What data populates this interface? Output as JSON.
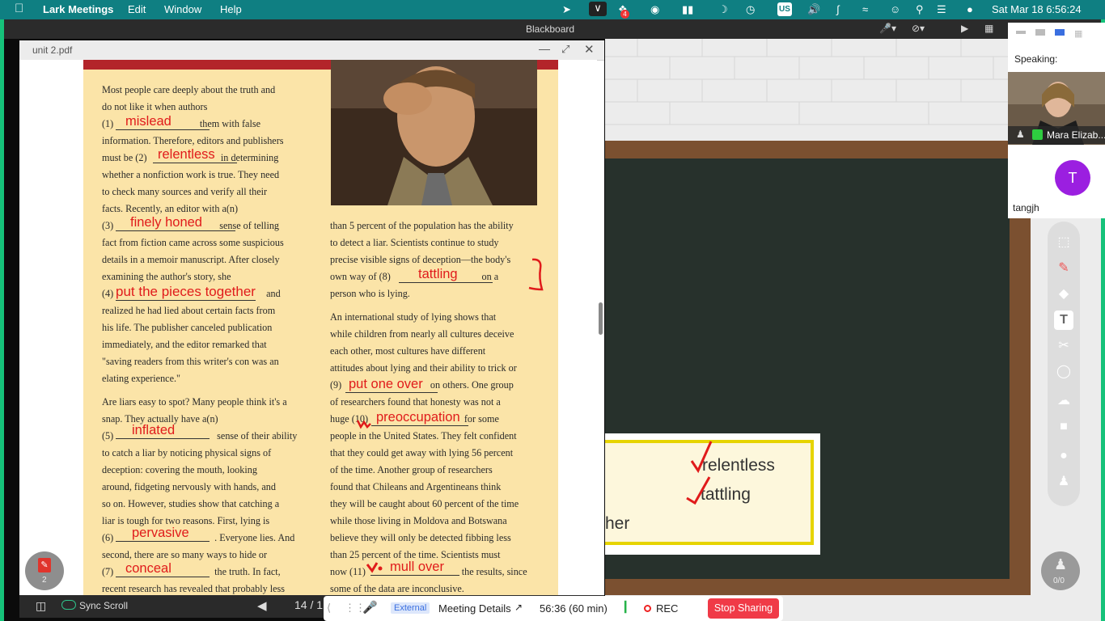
{
  "menubar": {
    "app": "Lark Meetings",
    "menus": [
      "Edit",
      "Window",
      "Help"
    ],
    "badge": "4",
    "input_source": "US",
    "datetime": "Sat Mar 18  6:56:24"
  },
  "share": {
    "window_title": "Blackboard"
  },
  "pdf": {
    "title": "unit 2.pdf",
    "left_column": [
      "Most people care deeply about the truth and",
      "do not like it when authors",
      "(1)                                   them with false",
      "information. Therefore, editors and publishers",
      "must be (2)                              in determining",
      "whether a nonfiction work is true. They need",
      "to check many sources and verify all their",
      "facts. Recently, an editor with a(n)",
      "(3)                                           sense of telling",
      "fact from fiction came across some suspicious",
      "details in a memoir manuscript. After closely",
      "examining the author's story, she",
      "(4)                                                              and",
      "realized he had lied about certain facts from",
      "his life. The publisher canceled publication",
      "immediately, and the editor remarked that",
      "\"saving readers from this writer's con was an",
      "elating experience.\"",
      "",
      "Are liars easy to spot? Many people think it's a",
      "snap. They actually have a(n)",
      "(5)                                          sense of their ability",
      "to catch a liar by noticing physical signs of",
      "deception: covering the mouth, looking",
      "around, fidgeting nervously with hands, and",
      "so on.  However, studies show that catching a",
      "liar is tough for two reasons. First, lying is",
      "(6)                                         . Everyone lies. And",
      "second, there are so many ways to hide or",
      "(7)                                         the truth. In fact,",
      "recent research has revealed that probably less"
    ],
    "right_column": [
      "than 5 percent of the population has the ability",
      "to detect a liar. Scientists continue to study",
      "precise visible signs of deception—the body's",
      "own way of (8)                                     on a",
      "person who is lying.",
      "",
      "An international study of lying shows that",
      "while children from nearly all cultures deceive",
      "each other, most cultures have different",
      "attitudes about lying and their ability to trick or",
      "(9)                                    on others. One group",
      "of researchers found that honesty was not a",
      "huge (10)                                       for some",
      "people in the United States. They felt confident",
      "that they could get away with lying 56 percent",
      "of the time. Another group of researchers",
      "found that Chileans and Argentineans think",
      "they will be caught about 60 percent of the time",
      "while those living in Moldova and Botswana",
      "believe they will only be detected fibbing less",
      "than 25 percent of the time. Scientists must",
      "now (11)                                       the results, since",
      "some of the data are inconclusive."
    ],
    "answers": {
      "a1": "mislead",
      "a2": "relentless",
      "a3": "finely honed",
      "a4": "put the pieces together",
      "a5": "inflated",
      "a6": "pervasive",
      "a7": "conceal",
      "a8": "tattling",
      "a9": "put one over",
      "a10": "preoccupation",
      "a11": "mull over"
    },
    "sidebar_badge": "2",
    "footer": {
      "sync_label": "Sync Scroll",
      "page_indicator": "14 / 1"
    }
  },
  "board": {
    "card_words": [
      "relentless",
      "tattling",
      "her"
    ],
    "page_counter": "0/0"
  },
  "speakers": {
    "heading": "Speaking:",
    "participant1": "Mara Elizab...",
    "participant2_initial": "T",
    "participant2": "tangjh"
  },
  "meeting_bar": {
    "external_tag": "External",
    "details": "Meeting Details",
    "timer": "56:36  (60 min)",
    "rec": "REC",
    "stop_sharing": "Stop Sharing"
  },
  "colors": {
    "menubar": "#0f7f82",
    "share_border": "#16c27a",
    "answer_red": "#e01b1b",
    "stop_red": "#f03a47",
    "avatar_purple": "#9b1fe0"
  }
}
